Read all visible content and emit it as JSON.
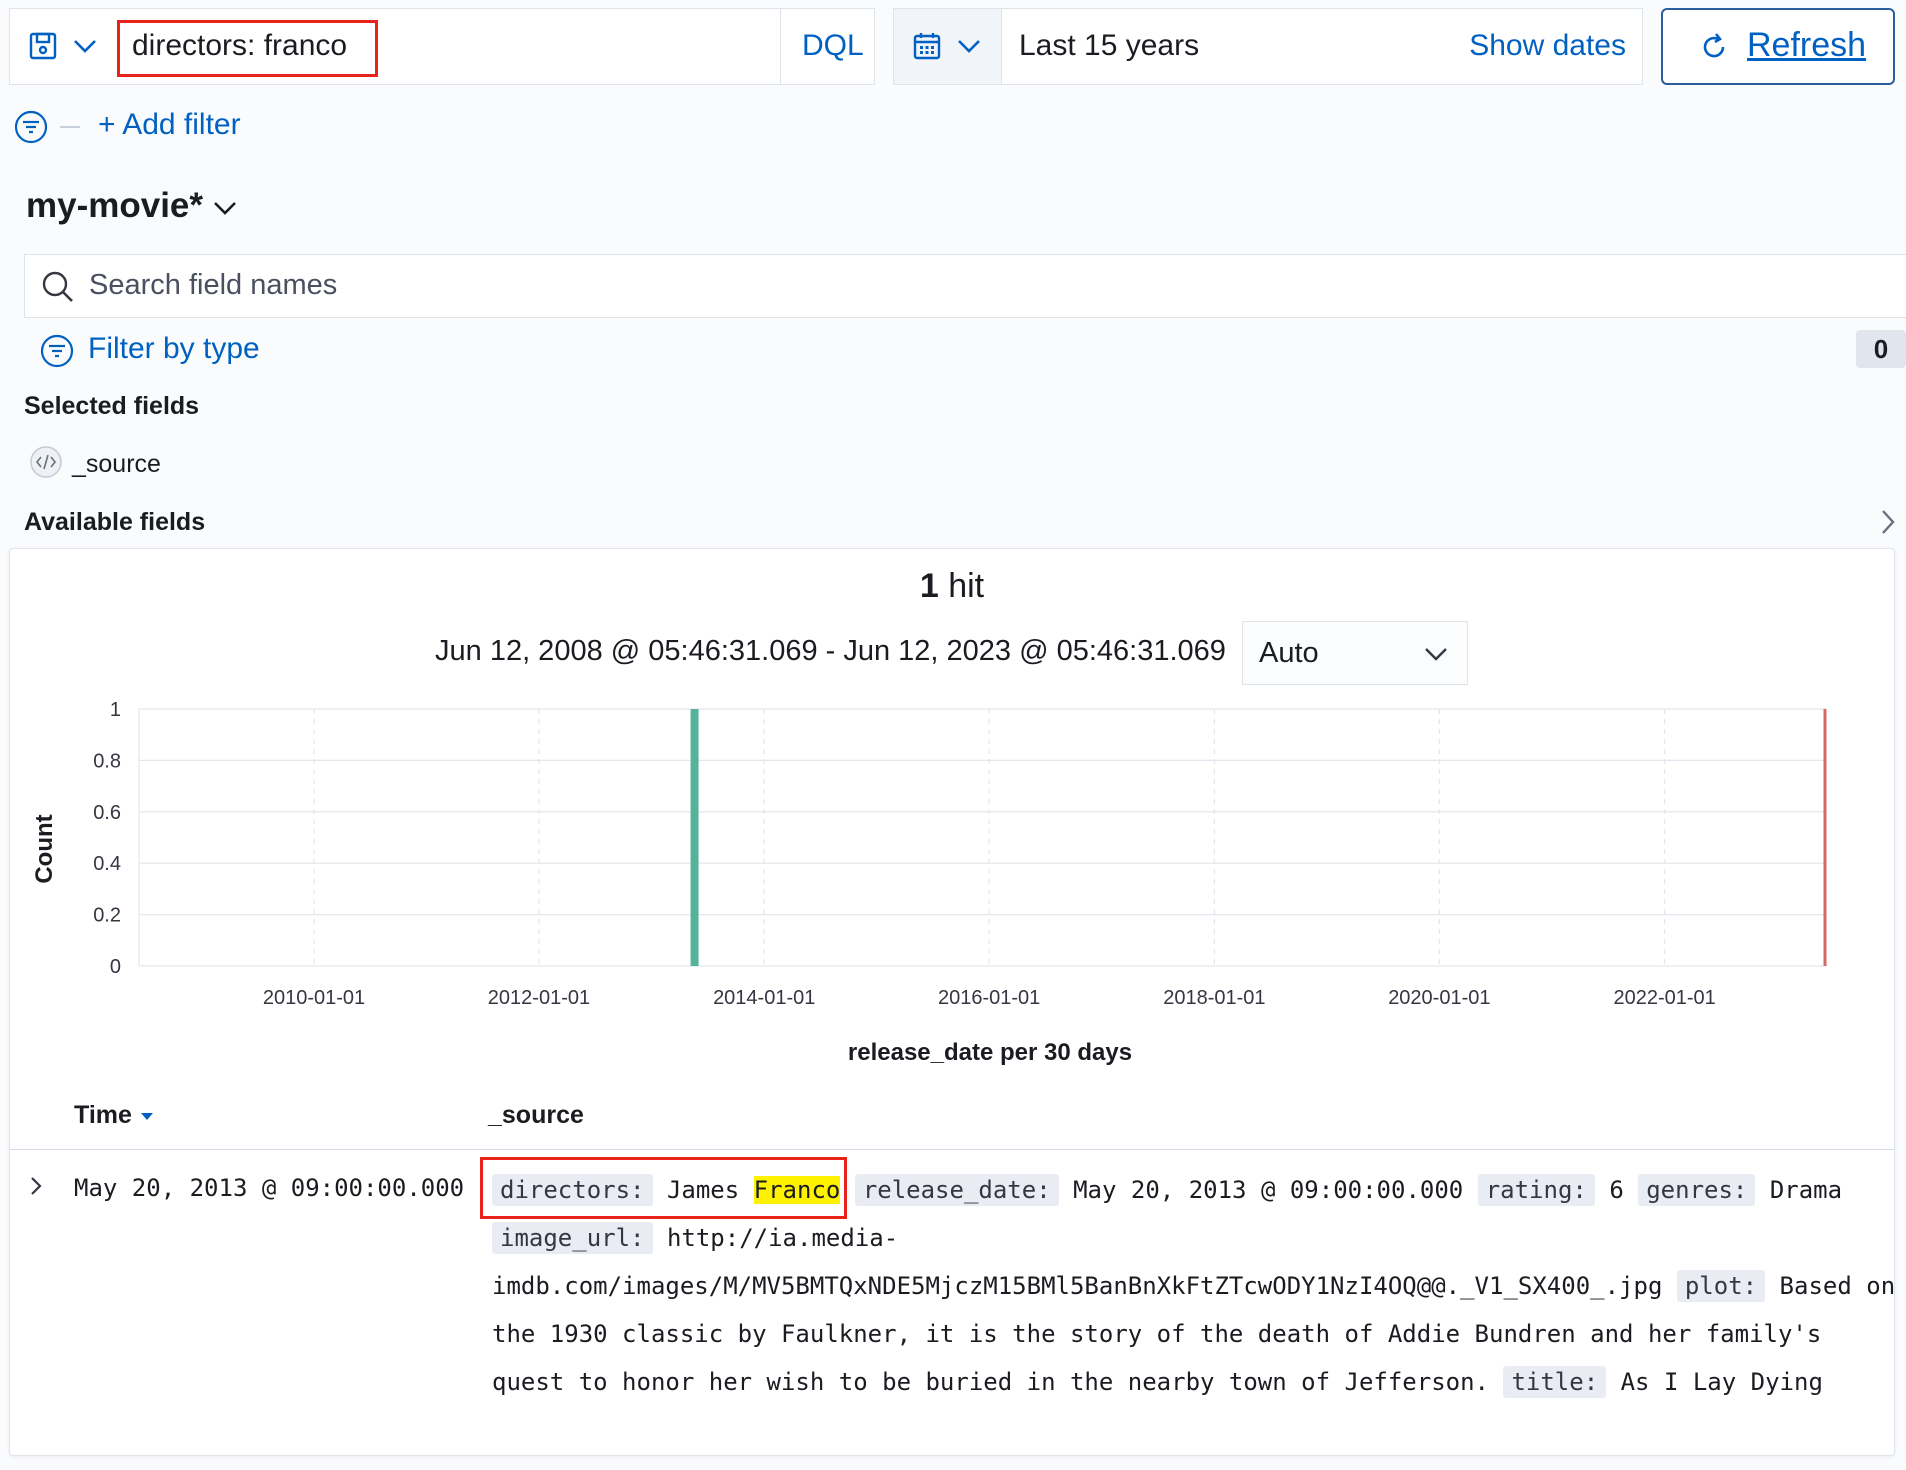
{
  "query": {
    "text": "directors: franco",
    "language": "DQL"
  },
  "time": {
    "range": "Last 15 years",
    "show_dates": "Show dates",
    "refresh": "Refresh"
  },
  "filters": {
    "add_filter": "+ Add filter"
  },
  "sidebar": {
    "index_pattern": "my-movie*",
    "search_placeholder": "Search field names",
    "filter_by_type": "Filter by type",
    "filter_count": "0",
    "selected_heading": "Selected fields",
    "selected_fields": [
      "_source"
    ],
    "available_heading": "Available fields"
  },
  "hits": {
    "count": "1",
    "label": "hit",
    "date_range": "Jun 12, 2008 @ 05:46:31.069 - Jun 12, 2023 @ 05:46:31.069",
    "interval": "Auto"
  },
  "chart_data": {
    "type": "bar",
    "ylabel": "Count",
    "xlabel": "release_date per 30 days",
    "ylim": [
      0,
      1
    ],
    "yticks": [
      "0",
      "0.2",
      "0.4",
      "0.6",
      "0.8",
      "1"
    ],
    "xticks": [
      "2010-01-01",
      "2012-01-01",
      "2014-01-01",
      "2016-01-01",
      "2018-01-01",
      "2020-01-01",
      "2022-01-01"
    ],
    "x_range": [
      "2008-06-12",
      "2023-06-12"
    ],
    "series": [
      {
        "x": "2013-05-20",
        "values": [
          1
        ]
      }
    ],
    "now_marker": "2023-06-12",
    "colors": {
      "bar": "#54b399",
      "marker": "#d36969"
    }
  },
  "table": {
    "columns": [
      "Time",
      "_source"
    ],
    "rows": [
      {
        "time": "May 20, 2013 @ 09:00:00.000",
        "fields": {
          "directors_label": "directors:",
          "directors_first": "James",
          "directors_highlight": "Franco",
          "release_date_label": "release_date:",
          "release_date": "May 20, 2013 @ 09:00:00.000",
          "rating_label": "rating:",
          "rating": "6",
          "genres_label": "genres:",
          "genres": "Drama",
          "image_url_label": "image_url:",
          "image_url_a": "http://ia.media-",
          "image_url_b": "imdb.com/images/M/MV5BMTQxNDE5MjczM15BMl5BanBnXkFtZTcwODY1NzI4OQ@@._V1_SX400_.jpg",
          "plot_label": "plot:",
          "plot_a": "Based on",
          "plot_b": "the 1930 classic by Faulkner, it is the story of the death of Addie Bundren and her family's",
          "plot_c": "quest to honor her wish to be buried in the nearby town of Jefferson.",
          "title_label": "title:",
          "title": "As I Lay Dying"
        }
      }
    ]
  }
}
